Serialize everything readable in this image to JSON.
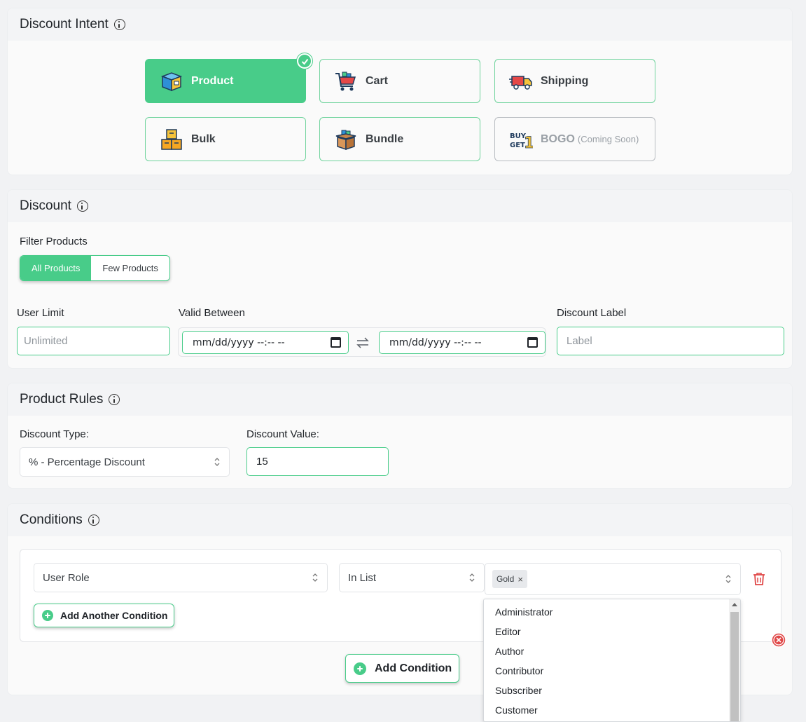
{
  "discount_intent": {
    "title": "Discount Intent",
    "options": [
      {
        "label": "Product",
        "icon": "box-icon",
        "active": true
      },
      {
        "label": "Cart",
        "icon": "shopping-cart-icon"
      },
      {
        "label": "Shipping",
        "icon": "delivery-truck-icon"
      },
      {
        "label": "Bulk",
        "icon": "stacked-boxes-icon"
      },
      {
        "label": "Bundle",
        "icon": "open-box-icon"
      },
      {
        "label": "BOGO",
        "suffix": "(Coming Soon)",
        "icon": "buy-get-one-icon",
        "disabled": true
      }
    ]
  },
  "discount": {
    "title": "Discount",
    "filter_label": "Filter Products",
    "filter_options": [
      "All Products",
      "Few Products"
    ],
    "user_limit_label": "User Limit",
    "user_limit_placeholder": "Unlimited",
    "valid_between_label": "Valid Between",
    "date_from": "mm/dd/yyyy --:-- --",
    "date_to": "mm/dd/yyyy --:-- --",
    "label_label": "Discount Label",
    "label_placeholder": "Label"
  },
  "product_rules": {
    "title": "Product Rules",
    "type_label": "Discount Type:",
    "type_value": "% - Percentage Discount",
    "value_label": "Discount Value:",
    "value": "15"
  },
  "conditions": {
    "title": "Conditions",
    "field": "User Role",
    "operator": "In List",
    "selected_tag": "Gold",
    "tag_remove": "×",
    "add_another": "Add Another Condition",
    "add_condition": "Add Condition",
    "dropdown_options": [
      "Administrator",
      "Editor",
      "Author",
      "Contributor",
      "Subscriber",
      "Customer"
    ]
  },
  "colors": {
    "accent": "#48cc89",
    "danger": "#e04848"
  }
}
